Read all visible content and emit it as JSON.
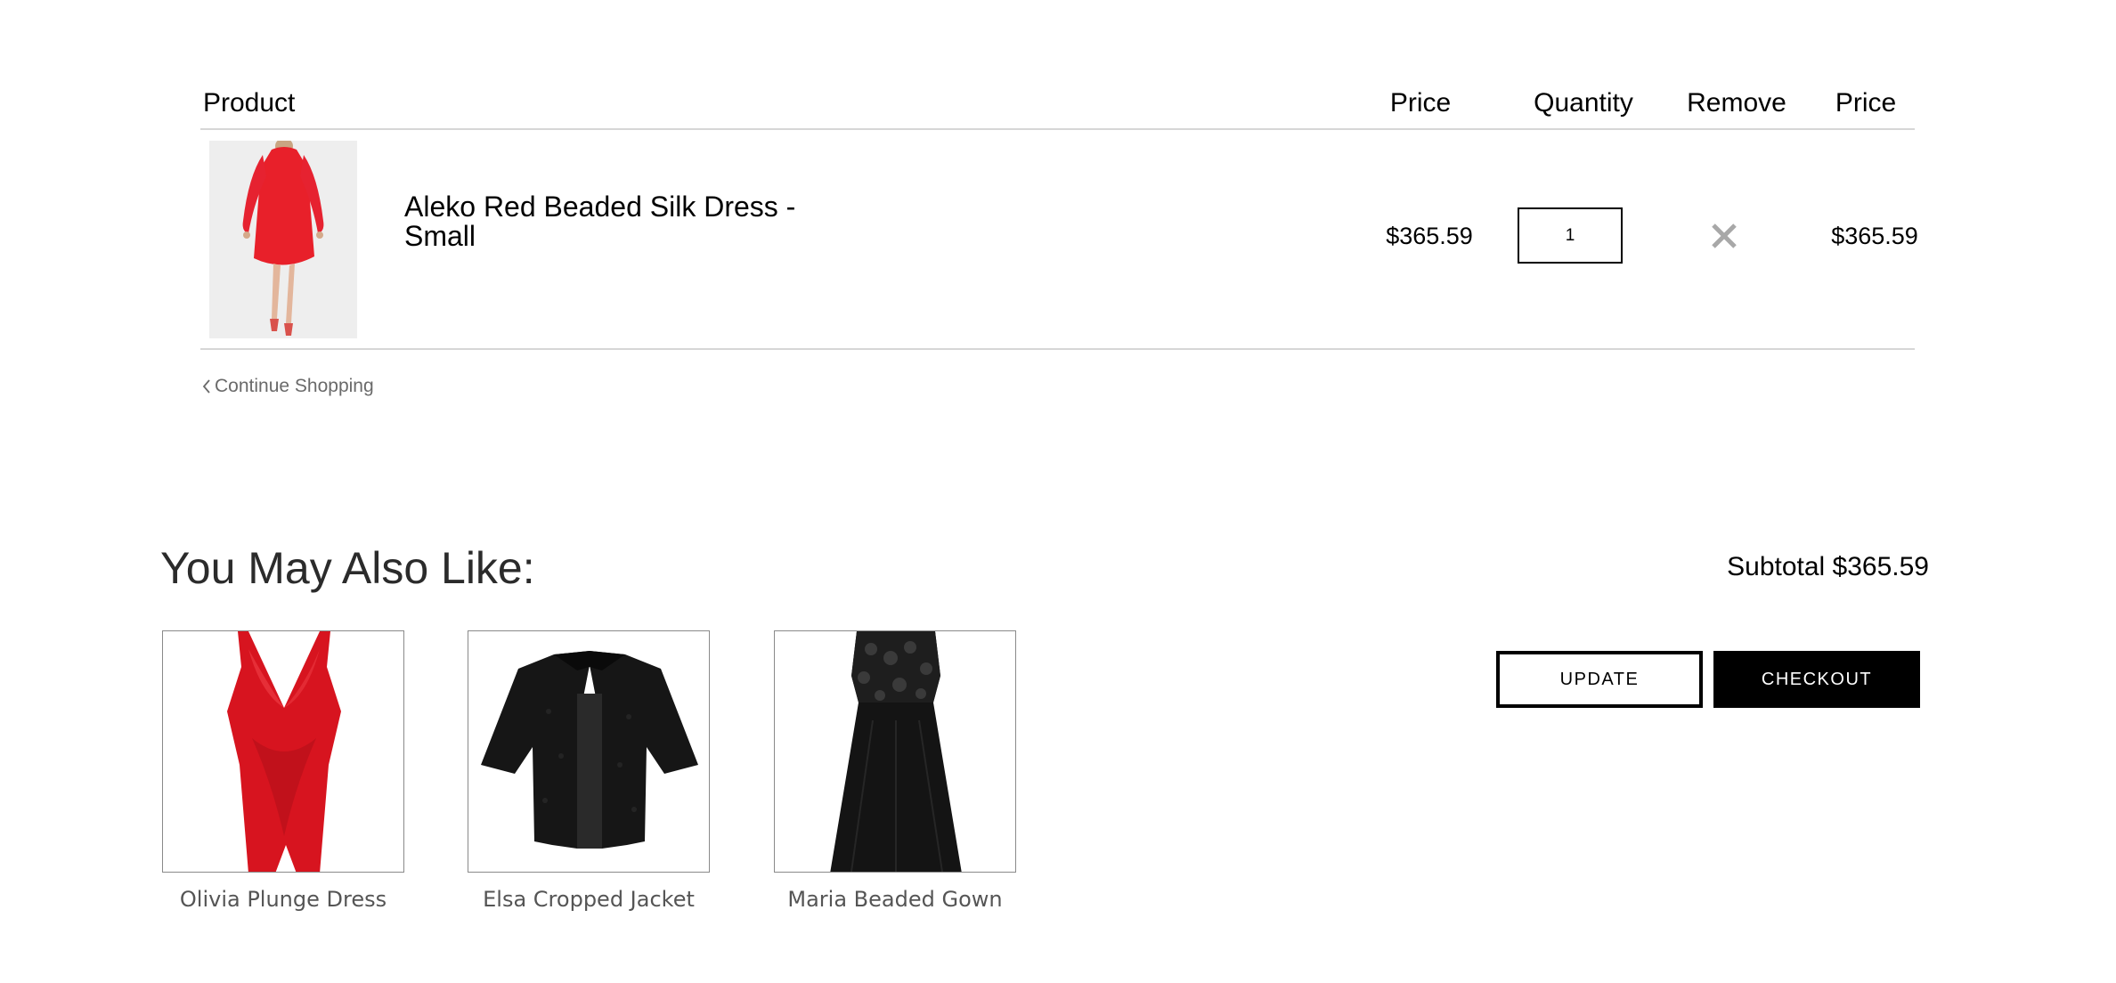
{
  "cart": {
    "headers": {
      "product": "Product",
      "price": "Price",
      "quantity": "Quantity",
      "remove": "Remove",
      "total": "Price"
    },
    "items": [
      {
        "name": "Aleko Red Beaded Silk Dress - Small",
        "price": "$365.59",
        "quantity": "1",
        "total": "$365.59",
        "image_icon": "red-dress-photo",
        "remove_icon": "close-icon"
      }
    ],
    "continue_label": "Continue Shopping"
  },
  "recommendations": {
    "title": "You May Also Like:",
    "items": [
      {
        "label": "Olivia Plunge Dress",
        "image_icon": "red-plunge-dress-photo"
      },
      {
        "label": "Elsa Cropped Jacket",
        "image_icon": "black-jacket-photo"
      },
      {
        "label": "Maria Beaded Gown",
        "image_icon": "black-gown-photo"
      }
    ]
  },
  "summary": {
    "subtotal": "Subtotal $365.59",
    "update_label": "UPDATE",
    "checkout_label": "CHECKOUT"
  },
  "colors": {
    "accent": "#000000",
    "divider": "#d6d6d6",
    "muted_text": "#6a6a6a",
    "dress_red": "#e8202a"
  }
}
